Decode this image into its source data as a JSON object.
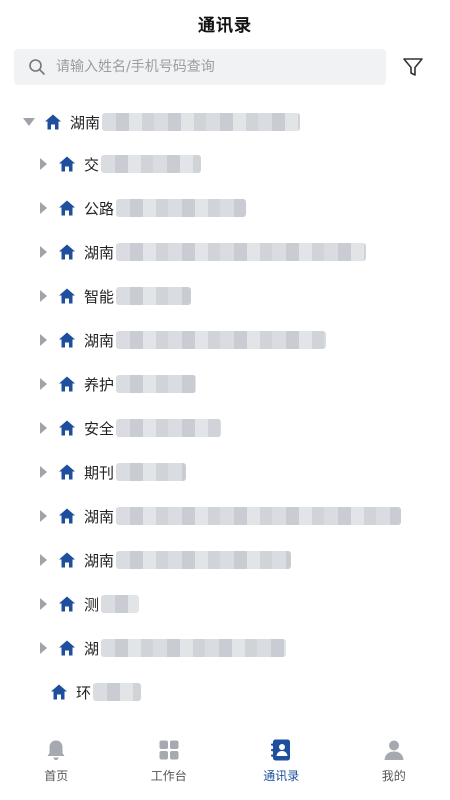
{
  "header": {
    "title": "通讯录"
  },
  "search": {
    "placeholder": "请输入姓名/手机号码查询",
    "value": ""
  },
  "tree": {
    "root": {
      "label": "湖南",
      "expanded": true
    },
    "children": [
      {
        "label": "交"
      },
      {
        "label": "公路"
      },
      {
        "label": "湖南"
      },
      {
        "label": "智能"
      },
      {
        "label": "湖南"
      },
      {
        "label": "养护"
      },
      {
        "label": "安全"
      },
      {
        "label": "期刊"
      },
      {
        "label": "湖南"
      },
      {
        "label": "湖南"
      },
      {
        "label": "测"
      },
      {
        "label": "湖"
      },
      {
        "label": "环"
      }
    ]
  },
  "tabbar": {
    "tabs": [
      {
        "label": "首页",
        "icon": "bell-icon"
      },
      {
        "label": "工作台",
        "icon": "grid-icon"
      },
      {
        "label": "通讯录",
        "icon": "contacts-book-icon",
        "active": true
      },
      {
        "label": "我的",
        "icon": "user-icon"
      }
    ]
  },
  "colors": {
    "accent": "#1e4f9c",
    "icon_gray": "#a6aab0",
    "search_bg": "#f1f2f4"
  }
}
